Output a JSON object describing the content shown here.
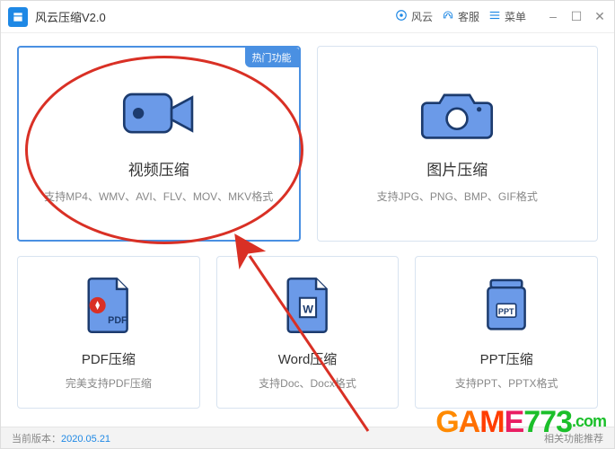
{
  "header": {
    "title": "风云压缩V2.0",
    "fengyun": "风云",
    "kefu": "客服",
    "menu": "菜单"
  },
  "badge_hot": "热门功能",
  "cards": {
    "video": {
      "title": "视频压缩",
      "sub": "支持MP4、WMV、AVI、FLV、MOV、MKV格式"
    },
    "image": {
      "title": "图片压缩",
      "sub": "支持JPG、PNG、BMP、GIF格式"
    },
    "pdf": {
      "title": "PDF压缩",
      "sub": "完美支持PDF压缩"
    },
    "word": {
      "title": "Word压缩",
      "sub": "支持Doc、Docx格式"
    },
    "ppt": {
      "title": "PPT压缩",
      "sub": "支持PPT、PPTX格式"
    }
  },
  "status": {
    "label": "当前版本：",
    "version": "2020.05.21",
    "right": "相关功能推荐"
  },
  "watermark": "GAME773.com",
  "colors": {
    "accent": "#4a90e2",
    "red": "#d93025",
    "icon_blue": "#6b9ae8"
  }
}
